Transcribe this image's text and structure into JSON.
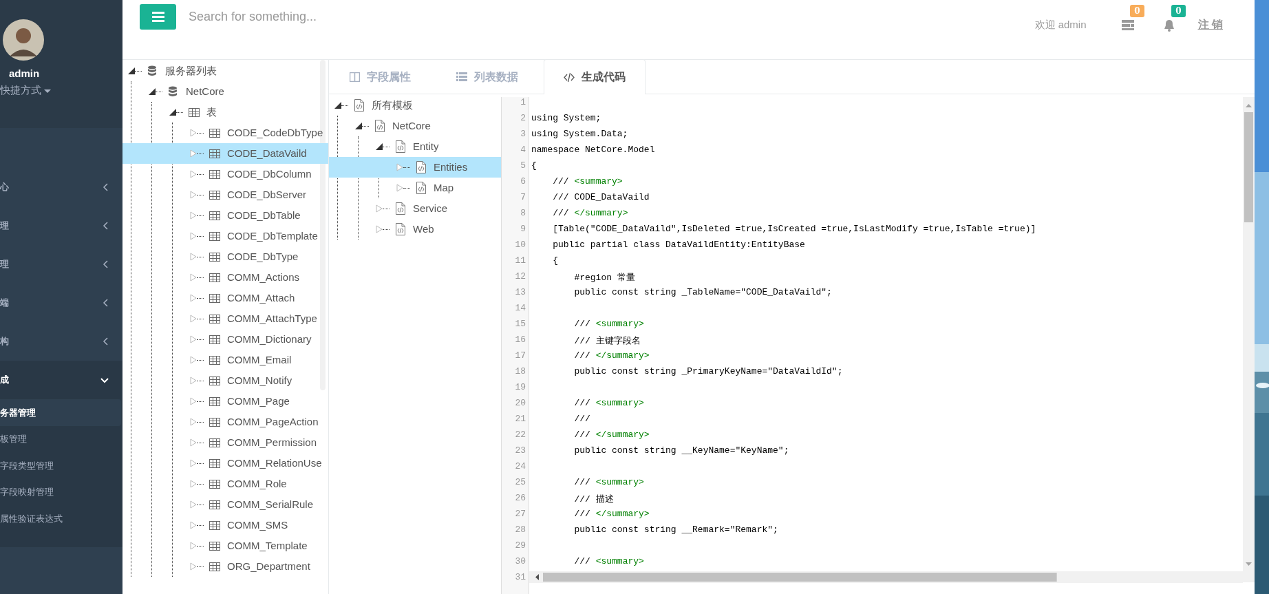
{
  "sidebar": {
    "user": {
      "name": "admin",
      "shortcut": "快捷方式"
    },
    "menu": [
      {
        "label": "心",
        "expanded": false
      },
      {
        "label": "理",
        "expanded": false
      },
      {
        "label": "理",
        "expanded": false
      },
      {
        "label": "端",
        "expanded": false
      },
      {
        "label": "构",
        "expanded": false
      },
      {
        "label": "成",
        "expanded": true,
        "children": [
          {
            "label": "务器管理",
            "selected": true
          },
          {
            "label": "板管理",
            "selected": false
          },
          {
            "label": "字段类型管理",
            "selected": false
          },
          {
            "label": "字段映射管理",
            "selected": false
          },
          {
            "label": "属性验证表达式",
            "selected": false
          }
        ]
      }
    ]
  },
  "topbar": {
    "search": {
      "placeholder": "Search for something..."
    },
    "welcome": "欢迎 admin",
    "task_badge": "0",
    "alert_badge": "0",
    "logout": "注 销"
  },
  "db_tree": [
    {
      "label": "服务器列表",
      "expanded": true,
      "selected": false,
      "children": [
        {
          "label": "NetCore",
          "expanded": true,
          "selected": false,
          "children": [
            {
              "label": "表",
              "expanded": true,
              "selected": false,
              "children": [
                {
                  "label": "CODE_CodeDbType",
                  "expanded": false,
                  "selected": false
                },
                {
                  "label": "CODE_DataVaild",
                  "expanded": false,
                  "selected": true
                },
                {
                  "label": "CODE_DbColumn",
                  "expanded": false,
                  "selected": false
                },
                {
                  "label": "CODE_DbServer",
                  "expanded": false,
                  "selected": false
                },
                {
                  "label": "CODE_DbTable",
                  "expanded": false,
                  "selected": false
                },
                {
                  "label": "CODE_DbTemplate",
                  "expanded": false,
                  "selected": false
                },
                {
                  "label": "CODE_DbType",
                  "expanded": false,
                  "selected": false
                },
                {
                  "label": "COMM_Actions",
                  "expanded": false,
                  "selected": false
                },
                {
                  "label": "COMM_Attach",
                  "expanded": false,
                  "selected": false
                },
                {
                  "label": "COMM_AttachType",
                  "expanded": false,
                  "selected": false
                },
                {
                  "label": "COMM_Dictionary",
                  "expanded": false,
                  "selected": false
                },
                {
                  "label": "COMM_Email",
                  "expanded": false,
                  "selected": false
                },
                {
                  "label": "COMM_Notify",
                  "expanded": false,
                  "selected": false
                },
                {
                  "label": "COMM_Page",
                  "expanded": false,
                  "selected": false
                },
                {
                  "label": "COMM_PageAction",
                  "expanded": false,
                  "selected": false
                },
                {
                  "label": "COMM_Permission",
                  "expanded": false,
                  "selected": false
                },
                {
                  "label": "COMM_RelationUse",
                  "expanded": false,
                  "selected": false
                },
                {
                  "label": "COMM_Role",
                  "expanded": false,
                  "selected": false
                },
                {
                  "label": "COMM_SerialRule",
                  "expanded": false,
                  "selected": false
                },
                {
                  "label": "COMM_SMS",
                  "expanded": false,
                  "selected": false
                },
                {
                  "label": "COMM_Template",
                  "expanded": false,
                  "selected": false
                },
                {
                  "label": "ORG_Department",
                  "expanded": false,
                  "selected": false
                }
              ]
            }
          ]
        }
      ]
    }
  ],
  "tabs": [
    {
      "label": "字段属性",
      "kind": "columns",
      "selected": false
    },
    {
      "label": "列表数据",
      "kind": "list",
      "selected": false
    },
    {
      "label": "生成代码",
      "kind": "code",
      "selected": true
    }
  ],
  "template_tree": [
    {
      "label": "所有模板",
      "expanded": true,
      "selected": false,
      "children": [
        {
          "label": "NetCore",
          "expanded": true,
          "selected": false,
          "children": [
            {
              "label": "Entity",
              "expanded": true,
              "selected": false,
              "children": [
                {
                  "label": "Entities",
                  "expanded": false,
                  "selected": true
                },
                {
                  "label": "Map",
                  "expanded": false,
                  "selected": false
                }
              ]
            },
            {
              "label": "Service",
              "expanded": false,
              "selected": false
            },
            {
              "label": "Web",
              "expanded": false,
              "selected": false
            }
          ]
        }
      ]
    }
  ],
  "code": [
    {
      "number": "1"
    },
    {
      "number": "2",
      "text": "using System;"
    },
    {
      "number": "3",
      "text": "using System.Data;"
    },
    {
      "number": "4",
      "text": "namespace NetCore.Model"
    },
    {
      "number": "5",
      "text": "{"
    },
    {
      "number": "6",
      "text": "    /// ",
      "tag": "<summary>"
    },
    {
      "number": "7",
      "text": "    /// CODE_DataVaild"
    },
    {
      "number": "8",
      "text": "    /// ",
      "tag": "</summary>"
    },
    {
      "number": "9",
      "text": "    [Table(\"CODE_DataVaild\",IsDeleted =true,IsCreated =true,IsLastModify =true,IsTable =true)]"
    },
    {
      "number": "10",
      "text": "    public partial class DataVaildEntity:EntityBase"
    },
    {
      "number": "11",
      "text": "    {"
    },
    {
      "number": "12",
      "text": "        #region 常量"
    },
    {
      "number": "13",
      "text": "        public const string _TableName=\"CODE_DataVaild\";"
    },
    {
      "number": "14"
    },
    {
      "number": "15",
      "text": "        /// ",
      "tag": "<summary>"
    },
    {
      "number": "16",
      "text": "        /// 主键字段名"
    },
    {
      "number": "17",
      "text": "        /// ",
      "tag": "</summary>"
    },
    {
      "number": "18",
      "text": "        public const string _PrimaryKeyName=\"DataVaildId\";"
    },
    {
      "number": "19"
    },
    {
      "number": "20",
      "text": "        /// ",
      "tag": "<summary>"
    },
    {
      "number": "21",
      "text": "        ///"
    },
    {
      "number": "22",
      "text": "        /// ",
      "tag": "</summary>"
    },
    {
      "number": "23",
      "text": "        public const string __KeyName=\"KeyName\";"
    },
    {
      "number": "24"
    },
    {
      "number": "25",
      "text": "        /// ",
      "tag": "<summary>"
    },
    {
      "number": "26",
      "text": "        /// 描述"
    },
    {
      "number": "27",
      "text": "        /// ",
      "tag": "</summary>"
    },
    {
      "number": "28",
      "text": "        public const string __Remark=\"Remark\";"
    },
    {
      "number": "29"
    },
    {
      "number": "30",
      "text": "        /// ",
      "tag": "<summary>"
    },
    {
      "number": "31"
    }
  ]
}
